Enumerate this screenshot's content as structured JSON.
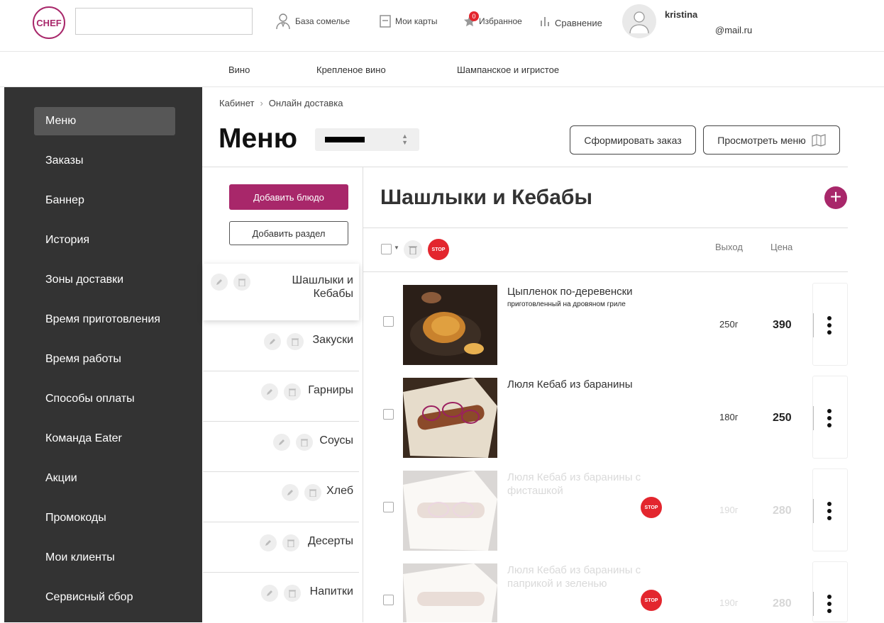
{
  "header": {
    "logo_text": "CHEF",
    "search_value": "",
    "nav": [
      {
        "label": "База сомелье",
        "icon": "sommelier-icon"
      },
      {
        "label": "Мои карты",
        "icon": "card-icon"
      },
      {
        "label": "Избранное",
        "icon": "star-icon",
        "badge": "0"
      },
      {
        "label": "Сравнение",
        "icon": "bar-chart-icon"
      }
    ],
    "user": {
      "name": "kristina",
      "email": "@mail.ru"
    }
  },
  "subnav": [
    "Вино",
    "Крепленое вино",
    "Шампанское и игристое"
  ],
  "sidebar": {
    "items": [
      "Меню",
      "Заказы",
      "Баннер",
      "История",
      "Зоны доставки",
      "Время приготовления",
      "Время работы",
      "Способы оплаты",
      "Команда Eater",
      "Акции",
      "Промокоды",
      "Мои клиенты",
      "Сервисный сбор"
    ],
    "active": "Меню"
  },
  "breadcrumb": [
    "Кабинет",
    "Онлайн доставка"
  ],
  "page": {
    "title": "Меню",
    "actions": {
      "create_order": "Сформировать заказ",
      "view_menu": "Просмотреть меню"
    }
  },
  "sections_panel": {
    "add_dish": "Добавить блюдо",
    "add_section": "Добавить раздел",
    "sections": [
      "Шашлыки и Кебабы",
      "Закуски",
      "Гарниры",
      "Соусы",
      "Хлеб",
      "Десерты",
      "Напитки"
    ],
    "active": "Шашлыки и Кебабы"
  },
  "category": {
    "title": "Шашлыки и Кебабы",
    "stop_label": "STOP",
    "columns": {
      "yield": "Выход",
      "price": "Цена"
    },
    "items": [
      {
        "name": "Цыпленок по-деревенски",
        "subtitle": "приготовленный на дровяном гриле",
        "yield": "250г",
        "price": "390",
        "stopped": false
      },
      {
        "name": "Люля Кебаб из баранины",
        "subtitle": "",
        "yield": "180г",
        "price": "250",
        "stopped": false
      },
      {
        "name": "Люля Кебаб из баранины с фисташкой",
        "subtitle": "",
        "yield": "190г",
        "price": "280",
        "stopped": true
      },
      {
        "name": "Люля Кебаб из баранины с паприкой и зеленью",
        "subtitle": "",
        "yield": "190г",
        "price": "280",
        "stopped": true
      }
    ]
  },
  "colors": {
    "accent": "#a8276a",
    "sidebar_bg": "#333333",
    "stop_red": "#e3262e"
  }
}
